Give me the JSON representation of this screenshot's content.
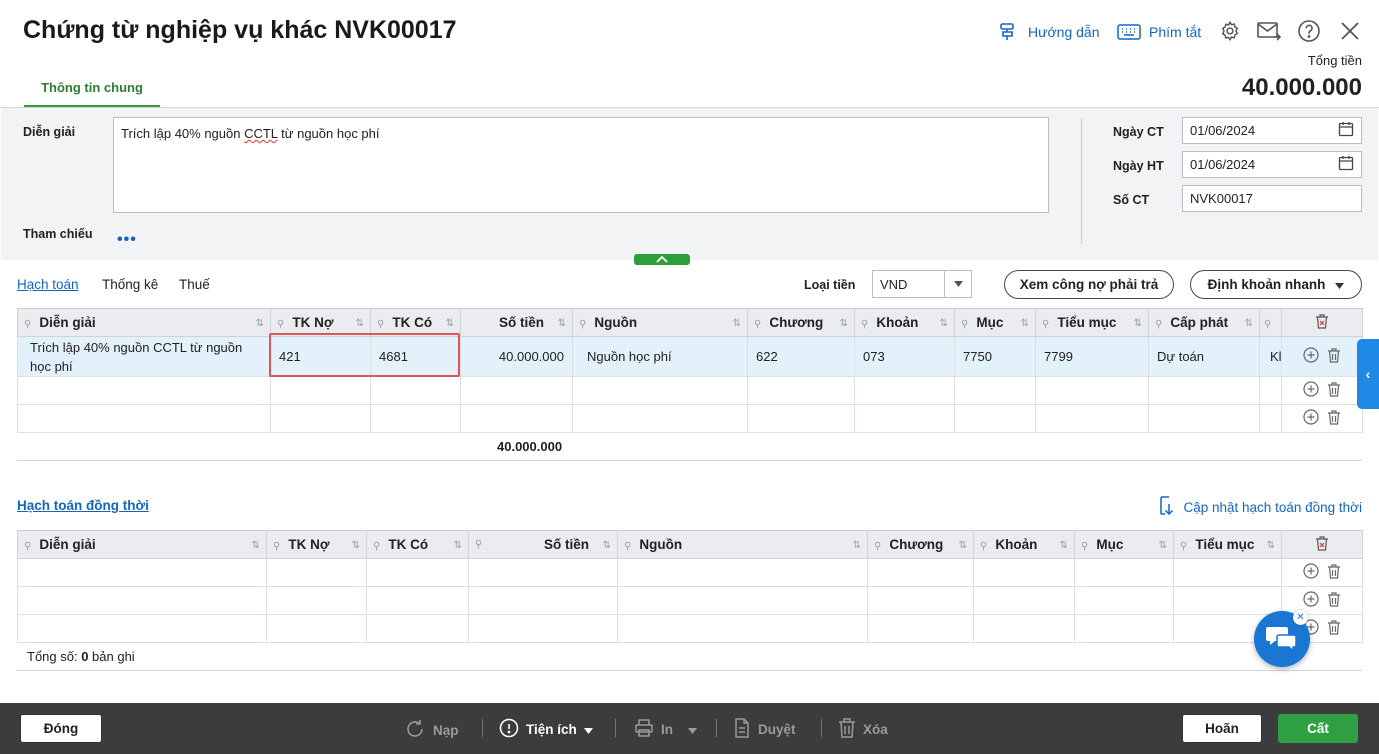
{
  "header": {
    "title": "Chứng từ nghiệp vụ khác NVK00017",
    "guide_label": "Hướng dẫn",
    "shortcut_label": "Phím tắt",
    "total_label": "Tổng tiền",
    "total_value": "40.000.000"
  },
  "tabs": {
    "general": "Thông tin chung"
  },
  "form": {
    "description_label": "Diễn giải",
    "description_pre": "Trích lập 40% nguồn ",
    "description_spell": "CCTL",
    "description_post": " từ nguồn học phí",
    "reference_label": "Tham chiếu",
    "reference_dots": "•••",
    "date_ct_label": "Ngày CT",
    "date_ct_value": "01/06/2024",
    "date_ht_label": "Ngày HT",
    "date_ht_value": "01/06/2024",
    "so_ct_label": "Số CT",
    "so_ct_value": "NVK00017"
  },
  "subtabs": {
    "accounting": "Hạch toán",
    "stats": "Thống kê",
    "tax": "Thuế"
  },
  "currency": {
    "label": "Loại tiền",
    "value": "VND"
  },
  "buttons": {
    "view_debt": "Xem công nợ phải trả",
    "quick_entry": "Định khoản nhanh"
  },
  "grid1": {
    "headers": [
      "Diễn giải",
      "TK Nợ",
      "TK Có",
      "Số tiền",
      "Nguồn",
      "Chương",
      "Khoản",
      "Mục",
      "Tiểu mục",
      "Cấp phát"
    ],
    "row": {
      "desc": "Trích lập 40% nguồn CCTL từ nguồn học phí",
      "tk_no": "421",
      "tk_co": "4681",
      "amount": "40.000.000",
      "source": "Nguồn học phí",
      "chapter": "622",
      "section": "073",
      "item": "7750",
      "subitem": "7799",
      "allocation": "Dự toán",
      "extra": "Kl"
    },
    "sum": "40.000.000"
  },
  "grid2": {
    "title": "Hạch toán đồng thời",
    "update_link": "Cập nhật hạch toán đồng thời",
    "headers": [
      "Diễn giải",
      "TK Nợ",
      "TK Có",
      "Số tiền",
      "Nguồn",
      "Chương",
      "Khoản",
      "Mục",
      "Tiểu mục"
    ],
    "count_prefix": "Tổng số: ",
    "count_value": "0",
    "count_suffix": " bản ghi"
  },
  "footer": {
    "close": "Đóng",
    "reload": "Nạp",
    "utilities": "Tiện ích",
    "print": "In",
    "approve": "Duyệt",
    "delete": "Xóa",
    "cancel": "Hoãn",
    "save": "Cất"
  },
  "colors": {
    "accent_blue": "#1565c0",
    "accent_green": "#2e9d3c",
    "selected_row": "#e3f1fb",
    "footer_bg": "#3c3c3c"
  }
}
